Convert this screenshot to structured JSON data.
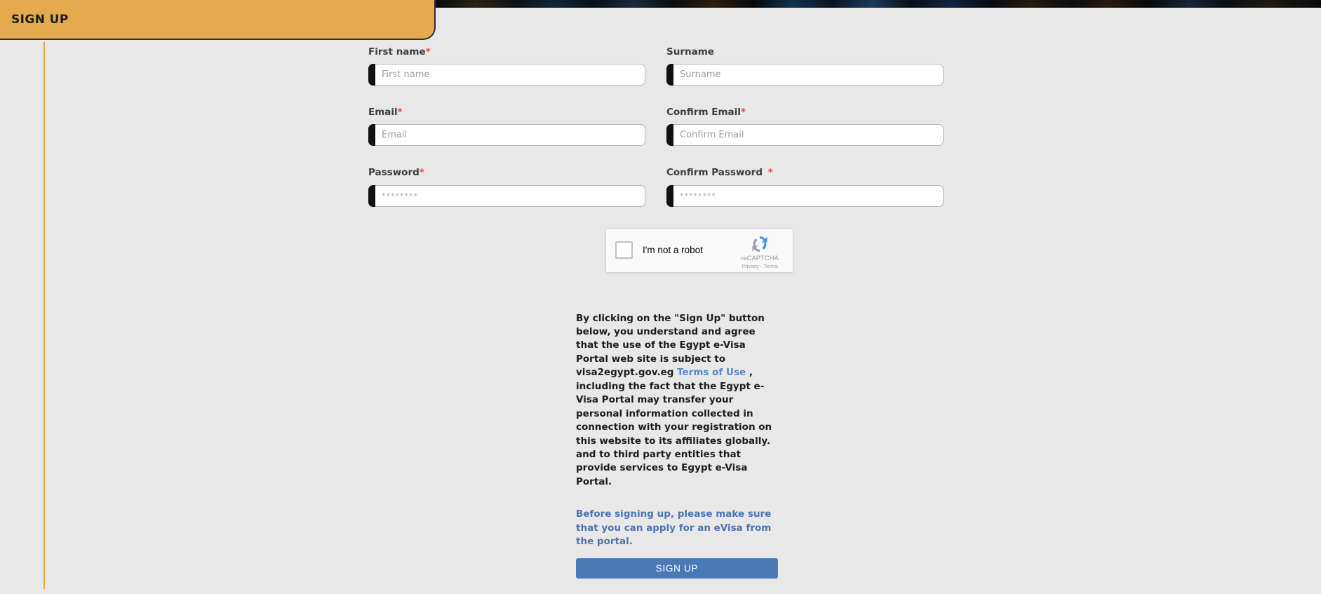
{
  "header": {
    "tab_label": "SIGN UP"
  },
  "theme": {
    "page_background": "#e8e8e8",
    "tab_orange": "#e4aa4d",
    "rule_orange": "#e3a73c",
    "accent_bar": "#111111",
    "required_red": "#e8453c",
    "link_blue": "#5b86c4",
    "notice_blue": "#4c74b0",
    "button_blue": "#4a7ab6"
  },
  "form": {
    "fields": [
      {
        "label": "First name",
        "required": true,
        "required_mark": "*",
        "spaced_mark": false,
        "placeholder": "First name",
        "value": "",
        "type": "text"
      },
      {
        "label": "Surname",
        "required": false,
        "required_mark": "",
        "spaced_mark": false,
        "placeholder": "Surname",
        "value": "",
        "type": "text"
      },
      {
        "label": "Email",
        "required": true,
        "required_mark": "*",
        "spaced_mark": false,
        "placeholder": "Email",
        "value": "",
        "type": "text"
      },
      {
        "label": "Confirm Email",
        "required": true,
        "required_mark": "*",
        "spaced_mark": false,
        "placeholder": "Confirm Email",
        "value": "",
        "type": "text"
      },
      {
        "label": "Password",
        "required": true,
        "required_mark": "*",
        "spaced_mark": false,
        "placeholder": "********",
        "value": "",
        "type": "password"
      },
      {
        "label": "Confirm Password ",
        "required": true,
        "required_mark": "*",
        "spaced_mark": true,
        "placeholder": "********",
        "value": "",
        "type": "password"
      }
    ]
  },
  "recaptcha": {
    "checkbox_checked": false,
    "label": "I'm not a robot",
    "brand_name": "reCAPTCHA",
    "privacy_label": "Privacy",
    "separator": "-",
    "terms_label": "Terms",
    "logo_icon": "recaptcha-arrows-icon"
  },
  "legal": {
    "part_one": "By clicking on the \"Sign Up\" button below, you understand and agree that the use of the Egypt e-Visa Portal web site is subject to visa2egypt.gov.eg ",
    "terms_link": "Terms of Use",
    "part_two": " , including the fact that the Egypt e-Visa Portal may transfer your personal information collected in connection with your registration on this website to its affiliates globally. and to third party entities that provide services to Egypt e-Visa Portal."
  },
  "notice": {
    "text": "Before signing up, please make sure that you can apply for an eVisa from the portal."
  },
  "submit": {
    "label": "SIGN UP"
  }
}
